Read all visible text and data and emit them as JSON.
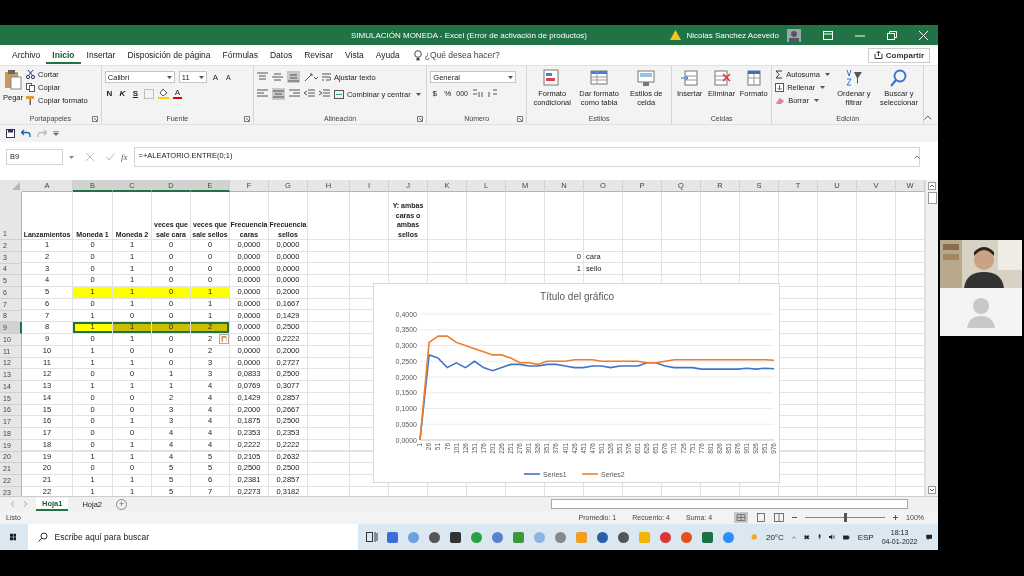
{
  "window": {
    "title": "SIMULACIÓN MONEDA  -  Excel (Error de activación de productos)",
    "user": "Nicolas Sanchez Acevedo"
  },
  "menu_tabs": [
    {
      "label": "Archivo",
      "selected": false
    },
    {
      "label": "Inicio",
      "selected": true
    },
    {
      "label": "Insertar",
      "selected": false
    },
    {
      "label": "Disposición de página",
      "selected": false
    },
    {
      "label": "Fórmulas",
      "selected": false
    },
    {
      "label": "Datos",
      "selected": false
    },
    {
      "label": "Revisar",
      "selected": false
    },
    {
      "label": "Vista",
      "selected": false
    },
    {
      "label": "Ayuda",
      "selected": false
    }
  ],
  "tell_me": {
    "placeholder": "¿Qué desea hacer?"
  },
  "share_button": "Compartir",
  "ribbon": {
    "clipboard": {
      "label": "Portapapeles",
      "paste": "Pegar",
      "cut": "Cortar",
      "copy": "Copiar",
      "format_painter": "Copiar formato"
    },
    "font": {
      "label": "Fuente",
      "font_name": "Calibri",
      "font_size": "11",
      "grow": "A",
      "shrink": "A",
      "bold": "N",
      "italic": "K",
      "underline": "S",
      "font_color": "A"
    },
    "alignment": {
      "label": "Alineación",
      "wrap": "Ajustar texto",
      "merge": "Combinar y centrar"
    },
    "number": {
      "label": "Número",
      "format": "General",
      "currency": "$",
      "percent": "%",
      "thousands": "000"
    },
    "styles": {
      "label": "Estilos",
      "conditional": "Formato\ncondicional",
      "as_table": "Dar formato\ncomo tabla",
      "cell_styles": "Estilos de\ncelda"
    },
    "cells": {
      "label": "Celdas",
      "insert": "Insertar",
      "delete": "Eliminar",
      "format": "Formato"
    },
    "editing": {
      "label": "Edición",
      "autosum": "Autosuma",
      "fill": "Rellenar",
      "clear": "Borrar",
      "sort": "Ordenar y\nfiltrar",
      "find": "Buscar y\nseleccionar"
    }
  },
  "formula_bar": {
    "name_box": "B9",
    "fx": "fx",
    "formula": "=+ALEATORIO.ENTRE(0;1)"
  },
  "sheet": {
    "columns": [
      {
        "label": "A",
        "selected": false
      },
      {
        "label": "B",
        "selected": true
      },
      {
        "label": "C",
        "selected": true
      },
      {
        "label": "D",
        "selected": true
      },
      {
        "label": "E",
        "selected": true
      },
      {
        "label": "F",
        "selected": false
      },
      {
        "label": "G",
        "selected": false
      },
      {
        "label": "H",
        "selected": false
      },
      {
        "label": "I",
        "selected": false
      },
      {
        "label": "J",
        "selected": false
      },
      {
        "label": "K",
        "selected": false
      },
      {
        "label": "L",
        "selected": false
      },
      {
        "label": "M",
        "selected": false
      },
      {
        "label": "N",
        "selected": false
      },
      {
        "label": "O",
        "selected": false
      },
      {
        "label": "P",
        "selected": false
      },
      {
        "label": "Q",
        "selected": false
      },
      {
        "label": "R",
        "selected": false
      },
      {
        "label": "S",
        "selected": false
      },
      {
        "label": "T",
        "selected": false
      },
      {
        "label": "U",
        "selected": false
      },
      {
        "label": "V",
        "selected": false
      },
      {
        "label": "W",
        "selected": false
      }
    ],
    "header_row": {
      "row_number": "1",
      "cells": [
        "Lanzamientos",
        "Moneda 1",
        "Moneda 2",
        "veces que sale cara",
        "veces que sale sellos",
        "Frecuencia caras",
        "Frecuencia sellos"
      ],
      "col_j": "Y: ambas caras o ambas sellos"
    },
    "rows": [
      {
        "row_number": "2",
        "cells": [
          "1",
          "0",
          "1",
          "0",
          "0",
          "0,0000",
          "0,0000"
        ],
        "highlighted": false,
        "selected": false
      },
      {
        "row_number": "3",
        "cells": [
          "2",
          "0",
          "1",
          "0",
          "0",
          "0,0000",
          "0,0000"
        ],
        "col_n": "0",
        "col_o": "cara",
        "highlighted": false,
        "selected": false
      },
      {
        "row_number": "4",
        "cells": [
          "3",
          "0",
          "1",
          "0",
          "0",
          "0,0000",
          "0,0000"
        ],
        "col_n": "1",
        "col_o": "sello",
        "highlighted": false,
        "selected": false
      },
      {
        "row_number": "5",
        "cells": [
          "4",
          "0",
          "1",
          "0",
          "0",
          "0,0000",
          "0,0000"
        ],
        "highlighted": false,
        "selected": false
      },
      {
        "row_number": "6",
        "cells": [
          "5",
          "1",
          "1",
          "0",
          "1",
          "0,0000",
          "0,2000"
        ],
        "highlighted": true,
        "selected": false
      },
      {
        "row_number": "7",
        "cells": [
          "6",
          "0",
          "1",
          "0",
          "1",
          "0,0000",
          "0,1667"
        ],
        "highlighted": false,
        "selected": false
      },
      {
        "row_number": "8",
        "cells": [
          "7",
          "1",
          "0",
          "0",
          "1",
          "0,0000",
          "0,1429"
        ],
        "highlighted": false,
        "selected": false
      },
      {
        "row_number": "9",
        "cells": [
          "8",
          "1",
          "1",
          "0",
          "2",
          "0,0000",
          "0,2500"
        ],
        "highlighted": true,
        "selected": true
      },
      {
        "row_number": "10",
        "cells": [
          "9",
          "0",
          "1",
          "0",
          "2",
          "0,0000",
          "0,2222"
        ],
        "highlighted": false,
        "selected": false
      },
      {
        "row_number": "11",
        "cells": [
          "10",
          "1",
          "0",
          "0",
          "2",
          "0,0000",
          "0,2000"
        ],
        "highlighted": false,
        "selected": false
      },
      {
        "row_number": "12",
        "cells": [
          "11",
          "1",
          "1",
          "0",
          "3",
          "0,0000",
          "0,2727"
        ],
        "highlighted": false,
        "selected": false
      },
      {
        "row_number": "13",
        "cells": [
          "12",
          "0",
          "0",
          "1",
          "3",
          "0,0833",
          "0,2500"
        ],
        "highlighted": false,
        "selected": false
      },
      {
        "row_number": "14",
        "cells": [
          "13",
          "1",
          "1",
          "1",
          "4",
          "0,0769",
          "0,3077"
        ],
        "highlighted": false,
        "selected": false
      },
      {
        "row_number": "15",
        "cells": [
          "14",
          "0",
          "0",
          "2",
          "4",
          "0,1429",
          "0,2857"
        ],
        "highlighted": false,
        "selected": false
      },
      {
        "row_number": "16",
        "cells": [
          "15",
          "0",
          "0",
          "3",
          "4",
          "0,2000",
          "0,2667"
        ],
        "highlighted": false,
        "selected": false
      },
      {
        "row_number": "17",
        "cells": [
          "16",
          "0",
          "1",
          "3",
          "4",
          "0,1875",
          "0,2500"
        ],
        "highlighted": false,
        "selected": false
      },
      {
        "row_number": "18",
        "cells": [
          "17",
          "0",
          "0",
          "4",
          "4",
          "0,2353",
          "0,2353"
        ],
        "highlighted": false,
        "selected": false
      },
      {
        "row_number": "19",
        "cells": [
          "18",
          "0",
          "1",
          "4",
          "4",
          "0,2222",
          "0,2222"
        ],
        "highlighted": false,
        "selected": false
      },
      {
        "row_number": "20",
        "cells": [
          "19",
          "1",
          "1",
          "4",
          "5",
          "0,2105",
          "0,2632"
        ],
        "highlighted": false,
        "selected": false
      },
      {
        "row_number": "21",
        "cells": [
          "20",
          "0",
          "0",
          "5",
          "5",
          "0,2500",
          "0,2500"
        ],
        "highlighted": false,
        "selected": false
      },
      {
        "row_number": "22",
        "cells": [
          "21",
          "1",
          "1",
          "5",
          "6",
          "0,2381",
          "0,2857"
        ],
        "highlighted": false,
        "selected": false
      },
      {
        "row_number": "23",
        "cells": [
          "22",
          "1",
          "1",
          "5",
          "7",
          "0,2273",
          "0,3182"
        ],
        "highlighted": false,
        "selected": false
      }
    ],
    "chart": {
      "chart_data": {
        "type": "line",
        "title": "Título del gráfico",
        "grid": true,
        "legend": "bottom",
        "categories": [
          "1",
          "26",
          "51",
          "76",
          "101",
          "126",
          "151",
          "176",
          "201",
          "226",
          "251",
          "276",
          "301",
          "326",
          "351",
          "376",
          "401",
          "426",
          "451",
          "476",
          "501",
          "526",
          "551",
          "576",
          "601",
          "626",
          "651",
          "676",
          "701",
          "726",
          "751",
          "776",
          "801",
          "826",
          "851",
          "876",
          "901",
          "926",
          "951",
          "976"
        ],
        "ylim": [
          0,
          0.4
        ],
        "yticks": [
          {
            "value": 0,
            "label": "0,0000"
          },
          {
            "value": 0.05,
            "label": "0,0500"
          },
          {
            "value": 0.1,
            "label": "0,1000"
          },
          {
            "value": 0.15,
            "label": "0,1500"
          },
          {
            "value": 0.2,
            "label": "0,2000"
          },
          {
            "value": 0.25,
            "label": "0,2500"
          },
          {
            "value": 0.3,
            "label": "0,3000"
          },
          {
            "value": 0.35,
            "label": "0,3500"
          },
          {
            "value": 0.4,
            "label": "0,4000"
          }
        ],
        "series": [
          {
            "name": "Series1",
            "color": "#4472c4",
            "values": [
              0,
              0.27,
              0.26,
              0.23,
              0.245,
              0.23,
              0.25,
              0.23,
              0.22,
              0.23,
              0.24,
              0.24,
              0.235,
              0.235,
              0.24,
              0.24,
              0.235,
              0.23,
              0.23,
              0.235,
              0.235,
              0.23,
              0.235,
              0.235,
              0.235,
              0.245,
              0.245,
              0.235,
              0.23,
              0.23,
              0.23,
              0.225,
              0.225,
              0.225,
              0.225,
              0.225,
              0.228,
              0.225,
              0.228,
              0.226
            ]
          },
          {
            "name": "Series2",
            "color": "#ed7d31",
            "values": [
              0,
              0.31,
              0.33,
              0.33,
              0.31,
              0.3,
              0.29,
              0.28,
              0.27,
              0.27,
              0.26,
              0.245,
              0.245,
              0.24,
              0.25,
              0.25,
              0.25,
              0.255,
              0.255,
              0.255,
              0.25,
              0.25,
              0.25,
              0.25,
              0.25,
              0.245,
              0.245,
              0.25,
              0.255,
              0.255,
              0.255,
              0.255,
              0.255,
              0.255,
              0.255,
              0.255,
              0.255,
              0.255,
              0.255,
              0.253
            ]
          }
        ]
      }
    }
  },
  "sheet_tabs": [
    {
      "label": "Hoja1",
      "selected": true
    },
    {
      "label": "Hoja2",
      "selected": false
    }
  ],
  "add_sheet": "+",
  "status_bar": {
    "ready": "Listo",
    "average": "Promedio: 1",
    "count": "Recuento: 4",
    "sum": "Suma: 4",
    "zoom": "100%",
    "level": 0.5
  },
  "taskbar": {
    "search": {
      "placeholder": "Escribe aquí para buscar"
    },
    "weather": "20°C",
    "language": "ESP",
    "time": "18:13",
    "date": "04-01-2022"
  }
}
